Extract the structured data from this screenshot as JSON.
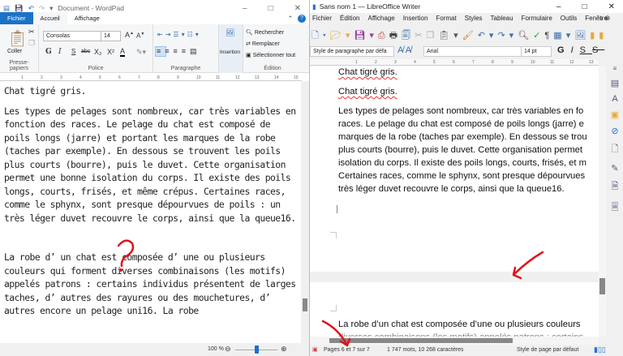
{
  "wordpad": {
    "title": "Document - WordPad",
    "tabs": [
      "Fichier",
      "Accueil",
      "Affichage"
    ],
    "ribbon": {
      "clipboard": {
        "paste": "Coller",
        "label": "Presse-papiers"
      },
      "font": {
        "family": "Consolas",
        "size": "14",
        "label": "Police",
        "buttons": [
          "G",
          "I",
          "S",
          "abc",
          "X₂",
          "X²",
          "A"
        ]
      },
      "paragraph": {
        "label": "Paragraphe"
      },
      "insert": {
        "label": "Insertion"
      },
      "edit": {
        "find": "Rechercher",
        "replace": "Remplacer",
        "select_all": "Sélectionner tout",
        "label": "Édition"
      }
    },
    "ruler": [
      "1",
      "2",
      "3",
      "4",
      "5",
      "6",
      "7",
      "8",
      "9",
      "10",
      "11",
      "12",
      "13",
      "14",
      "15"
    ],
    "document": [
      "Chat tigré gris.",
      "Les types de pelages sont nombreux, car très variables en fonction des races. Le pelage du chat est composé de poils longs (jarre) et portant les marques de la robe (taches par exemple). En dessous se trouvent les poils plus courts (bourre), puis le duvet. Cette organisation permet une bonne isolation du corps. Il existe des poils longs, courts, frisés, et même crépus. Certaines races, comme le sphynx, sont presque dépourvues de poils : un très léger duvet recouvre le corps, ainsi que la queue16.",
      "La robe d’ un chat est composée d’ une ou plusieurs couleurs qui forment diverses combinaisons (les motifs) appelés patrons : certains individus présentent de larges taches, d’ autres des rayures ou des mouchetures, d’ autres encore un pelage uni16. La robe"
    ],
    "status": {
      "zoom": "100 %",
      "zoom_level": 100
    }
  },
  "writer": {
    "title": "Sans nom 1 — LibreOffice Writer",
    "menu": [
      "Fichier",
      "Édition",
      "Affichage",
      "Insertion",
      "Format",
      "Styles",
      "Tableau",
      "Formulaire",
      "Outils",
      "Fenêtre"
    ],
    "para_style": "Style de paragraphe par défa",
    "font": "Arial",
    "size": "14 pt",
    "ruler": [
      "1",
      "2",
      "3",
      "4",
      "5",
      "6",
      "7",
      "8",
      "9",
      "10",
      "11",
      "12",
      "13"
    ],
    "page1": [
      "Chat tigré gris.",
      "Chat tigré gris.",
      [
        "Les types de pelages sont nombreux, car très variables en fo",
        "races. Le pelage du chat est composé de poils longs (jarre) e",
        "marques de la robe (taches par exemple). En dessous se trou",
        "plus courts (bourre), puis le duvet. Cette organisation permet",
        "isolation du corps. Il existe des poils longs, courts, frisés, et m",
        "Certaines races, comme le sphynx, sont presque dépourvues",
        "très léger duvet recouvre le corps, ainsi que la queue16."
      ]
    ],
    "page2": [
      "La robe d’un chat est composée d’une ou plusieurs couleurs",
      "diverses combinaisons (les motifs) appelés patrons : certains"
    ],
    "status": {
      "pages": "Pages 6 et 7 sur 7",
      "words": "1 747 mots, 10 268 caractères",
      "page_style": "Style de page par défaut"
    }
  },
  "annotations": {
    "question_mark": "?",
    "color": "#e0141e"
  }
}
